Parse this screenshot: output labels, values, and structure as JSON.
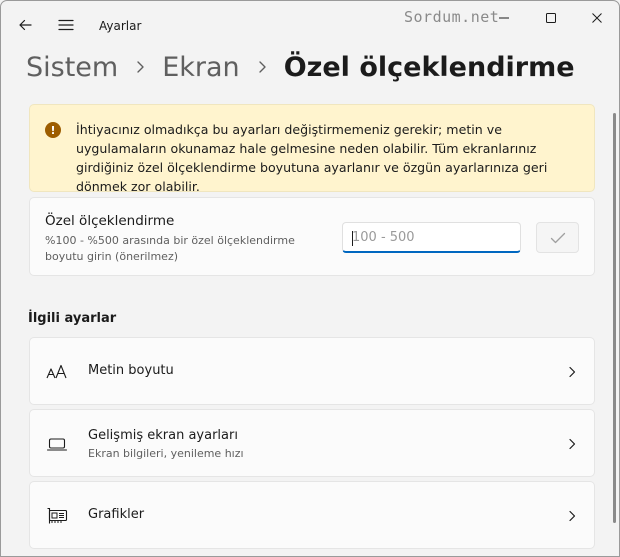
{
  "titlebar": {
    "app_title": "Ayarlar",
    "watermark": "Sordum.net"
  },
  "breadcrumb": {
    "items": [
      "Sistem",
      "Ekran"
    ],
    "current": "Özel ölçeklendirme"
  },
  "warning": {
    "icon": "!",
    "text": "İhtiyacınız olmadıkça bu ayarları değiştirmemeniz gerekir; metin ve uygulamaların okunamaz hale gelmesine neden olabilir. Tüm ekranlarınız girdiğiniz özel ölçeklendirme boyutuna ayarlanır ve özgün ayarlarınıza geri dönmek zor olabilir."
  },
  "custom_scale": {
    "title": "Özel ölçeklendirme",
    "description": "%100 - %500 arasında bir özel ölçeklendirme boyutu girin (önerilmez)",
    "input_value": "",
    "input_placeholder": "100 - 500"
  },
  "related": {
    "section_title": "İlgili ayarlar",
    "items": [
      {
        "label": "Metin boyutu",
        "subtitle": "",
        "icon": "text-size-icon"
      },
      {
        "label": "Gelişmiş ekran ayarları",
        "subtitle": "Ekran bilgileri, yenileme hızı",
        "icon": "monitor-icon"
      },
      {
        "label": "Grafikler",
        "subtitle": "",
        "icon": "graphics-card-icon"
      }
    ]
  },
  "colors": {
    "accent": "#0067c0",
    "warning_bg": "#fff4ce",
    "warning_icon": "#9d5d00",
    "window_bg": "#f3f3f3"
  }
}
